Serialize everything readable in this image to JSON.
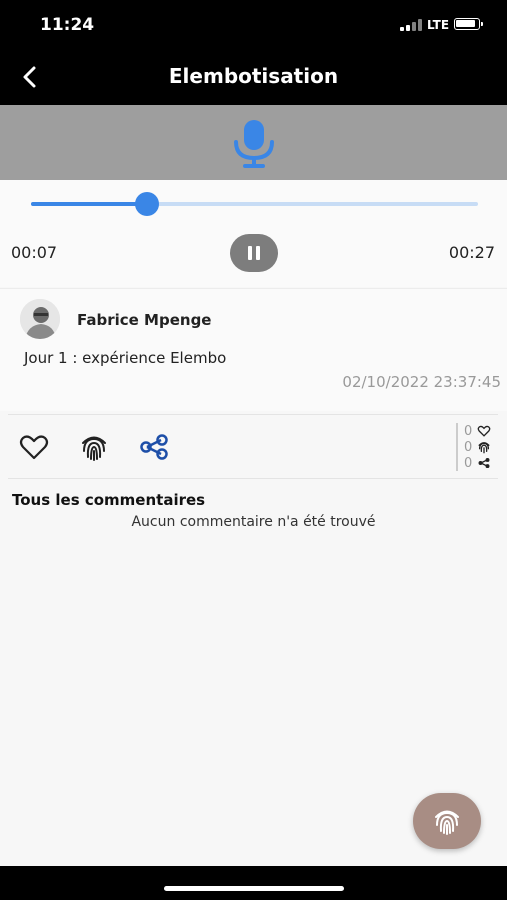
{
  "status_bar": {
    "time": "11:24",
    "network": "LTE",
    "icons": [
      "signal-icon",
      "battery-icon"
    ]
  },
  "header": {
    "title": "Elembotisation",
    "back_icon": "chevron-left-icon"
  },
  "banner": {
    "icon": "microphone-icon",
    "background": "#9e9e9e",
    "icon_color": "#3a86e6"
  },
  "player": {
    "current_time": "00:07",
    "total_time": "00:27",
    "progress": 0.26,
    "control_icon": "pause-icon",
    "accent": "#3a86e6"
  },
  "post": {
    "author": "Fabrice Mpenge",
    "text": "Jour 1 : expérience Elembo",
    "date": "02/10/2022 23:37:45"
  },
  "actions": {
    "items": [
      "heart-icon",
      "fingerprint-icon",
      "share-icon"
    ],
    "share_color": "#1e4fa8",
    "counts": [
      {
        "value": "0",
        "icon": "heart-icon"
      },
      {
        "value": "0",
        "icon": "fingerprint-icon"
      },
      {
        "value": "0",
        "icon": "share-icon"
      }
    ]
  },
  "comments": {
    "title": "Tous les commentaires",
    "empty_message": "Aucun commentaire n'a été trouvé"
  },
  "fab": {
    "icon": "fingerprint-icon",
    "color": "#a88d84"
  }
}
